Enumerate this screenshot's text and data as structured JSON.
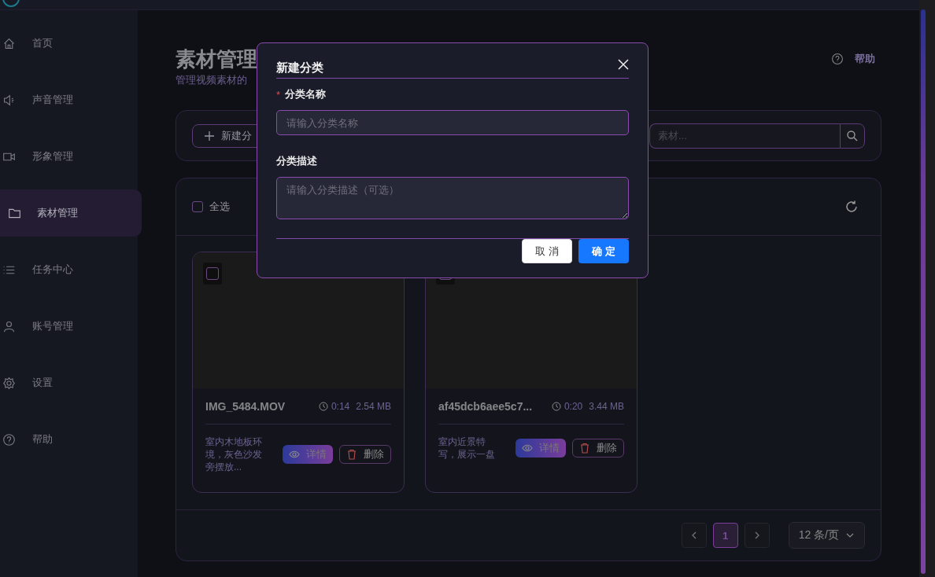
{
  "sidebar": {
    "items": [
      {
        "label": "首页",
        "selected": false
      },
      {
        "label": "声音管理",
        "selected": false
      },
      {
        "label": "形象管理",
        "selected": false
      },
      {
        "label": "素材管理",
        "selected": true
      },
      {
        "label": "任务中心",
        "selected": false
      },
      {
        "label": "账号管理",
        "selected": false
      },
      {
        "label": "设置",
        "selected": false
      },
      {
        "label": "帮助",
        "selected": false
      }
    ]
  },
  "header": {
    "title": "素材管理",
    "subtitle": "管理视频素材的",
    "help": "帮助"
  },
  "toolbar": {
    "new_button": "新建分",
    "search": {
      "placeholder": "素材..."
    }
  },
  "list": {
    "select_all": {
      "label": "全选",
      "checked": false
    },
    "items": [
      {
        "name": "IMG_5484.MOV",
        "duration": "0:14",
        "size": "2.54 MB",
        "description": "室内木地板环境，灰色沙发旁摆放...",
        "checked": false,
        "detail": "详情",
        "delete": "删除"
      },
      {
        "name": "af45dcb6aee5c7...",
        "duration": "0:20",
        "size": "3.44 MB",
        "description": "室内近景特写，展示一盘",
        "checked": false,
        "detail": "详情",
        "delete": "删除"
      }
    ]
  },
  "pagination": {
    "pages": [
      {
        "label": "1",
        "selected": true
      }
    ],
    "page_size": "12 条/页"
  },
  "dialog": {
    "title": "新建分类",
    "fields": [
      {
        "label": "分类名称",
        "required_mark": "*",
        "kind": "input",
        "placeholder": "请输入分类名称"
      },
      {
        "label": "分类描述",
        "kind": "textarea",
        "placeholder": "请输入分类描述（可选）"
      }
    ],
    "cancel": "取 消",
    "confirm": "确 定"
  }
}
